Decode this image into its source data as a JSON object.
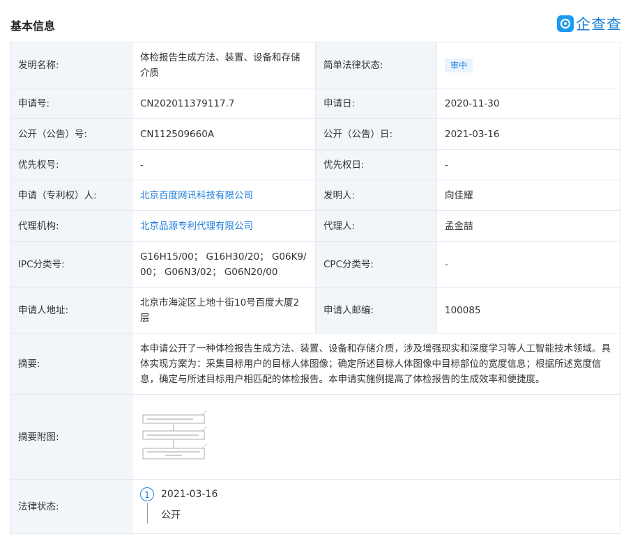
{
  "header": {
    "title": "基本信息",
    "logo_text": "企查查"
  },
  "colors": {
    "label_bg": "#f2f6fb",
    "border": "#e4e8ef",
    "link": "#1f7fdb",
    "badge_bg": "#e8f3fe"
  },
  "rows": {
    "name": {
      "label": "发明名称:",
      "value": "体检报告生成方法、装置、设备和存储介质",
      "label2": "简单法律状态:",
      "value2": "审中"
    },
    "app_no": {
      "label": "申请号:",
      "value": "CN202011379117.7",
      "label2": "申请日:",
      "value2": "2020-11-30"
    },
    "pub_no": {
      "label": "公开（公告）号:",
      "value": "CN112509660A",
      "label2": "公开（公告）日:",
      "value2": "2021-03-16"
    },
    "priority": {
      "label": "优先权号:",
      "value": "-",
      "label2": "优先权日:",
      "value2": "-"
    },
    "applicant": {
      "label": "申请（专利权）人:",
      "value": "北京百度网讯科技有限公司",
      "label2": "发明人:",
      "value2": "向佳耀"
    },
    "agency": {
      "label": "代理机构:",
      "value": "北京品源专利代理有限公司",
      "label2": "代理人:",
      "value2": "孟金喆"
    },
    "ipc": {
      "label": "IPC分类号:",
      "value": "G16H15/00； G16H30/20； G06K9/00； G06N3/02； G06N20/00",
      "label2": "CPC分类号:",
      "value2": "-"
    },
    "address": {
      "label": "申请人地址:",
      "value": "北京市海淀区上地十街10号百度大厦2层",
      "label2": "申请人邮编:",
      "value2": "100085"
    },
    "abstract": {
      "label": "摘要:",
      "value": "本申请公开了一种体检报告生成方法、装置、设备和存储介质，涉及增强现实和深度学习等人工智能技术领域。具体实现方案为：采集目标用户的目标人体图像；确定所述目标人体图像中目标部位的宽度信息；根据所述宽度信息，确定与所述目标用户相匹配的体检报告。本申请实施例提高了体检报告的生成效率和便捷度。"
    },
    "figure": {
      "label": "摘要附图:"
    },
    "legal": {
      "label": "法律状态:",
      "step": "1",
      "date": "2021-03-16",
      "status": "公开"
    }
  }
}
